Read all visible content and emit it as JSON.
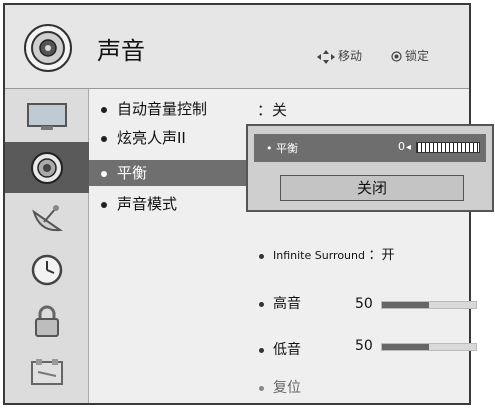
{
  "header": {
    "title": "声音",
    "hint_move": "移动",
    "hint_lock": "锁定"
  },
  "sidebar": {
    "items": [
      {
        "icon": "picture-icon"
      },
      {
        "icon": "audio-icon",
        "active": true
      },
      {
        "icon": "satellite-dish-icon"
      },
      {
        "icon": "clock-icon"
      },
      {
        "icon": "lock-icon"
      },
      {
        "icon": "option-icon"
      }
    ]
  },
  "menu": {
    "items": [
      {
        "label": "自动音量控制",
        "value": "：关"
      },
      {
        "label": "炫亮人声II"
      },
      {
        "label": "平衡",
        "selected": true
      },
      {
        "label": "声音模式"
      }
    ]
  },
  "popup": {
    "label": "平衡",
    "value": "0",
    "close_label": "关闭"
  },
  "options": {
    "surround_label": "Infinite Surround",
    "surround_value": "：开",
    "treble_label": "高音",
    "treble_value": "50",
    "treble_level": 0.5,
    "bass_label": "低音",
    "bass_value": "50",
    "bass_level": 0.5,
    "reset_label": "复位"
  },
  "colors": {
    "selected_bg": "#6f6f6f",
    "sidebar_active": "#5a5a5a"
  }
}
